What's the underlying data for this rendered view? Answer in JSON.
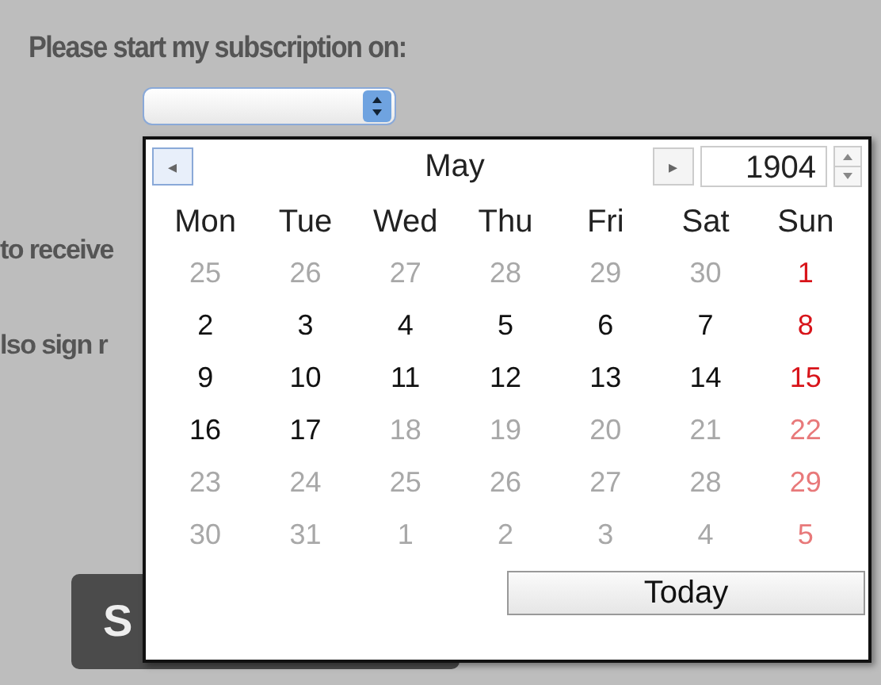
{
  "form": {
    "heading": "Please start my subscription on:",
    "partial_line_1": "to receive",
    "partial_line_2": "lso sign r",
    "submit_button": "S"
  },
  "calendar": {
    "prev_button": "◂",
    "month": "May",
    "next_button": "▸",
    "year": "1904",
    "weekdays": [
      "Mon",
      "Tue",
      "Wed",
      "Thu",
      "Fri",
      "Sat",
      "Sun"
    ],
    "weeks": [
      [
        {
          "day": "25",
          "disabled": true,
          "holiday": false
        },
        {
          "day": "26",
          "disabled": true,
          "holiday": false
        },
        {
          "day": "27",
          "disabled": true,
          "holiday": false
        },
        {
          "day": "28",
          "disabled": true,
          "holiday": false
        },
        {
          "day": "29",
          "disabled": true,
          "holiday": false
        },
        {
          "day": "30",
          "disabled": true,
          "holiday": false
        },
        {
          "day": "1",
          "disabled": false,
          "holiday": true
        }
      ],
      [
        {
          "day": "2",
          "disabled": false,
          "holiday": false
        },
        {
          "day": "3",
          "disabled": false,
          "holiday": false
        },
        {
          "day": "4",
          "disabled": false,
          "holiday": false
        },
        {
          "day": "5",
          "disabled": false,
          "holiday": false
        },
        {
          "day": "6",
          "disabled": false,
          "holiday": false
        },
        {
          "day": "7",
          "disabled": false,
          "holiday": false
        },
        {
          "day": "8",
          "disabled": false,
          "holiday": true
        }
      ],
      [
        {
          "day": "9",
          "disabled": false,
          "holiday": false
        },
        {
          "day": "10",
          "disabled": false,
          "holiday": false
        },
        {
          "day": "11",
          "disabled": false,
          "holiday": false
        },
        {
          "day": "12",
          "disabled": false,
          "holiday": false
        },
        {
          "day": "13",
          "disabled": false,
          "holiday": false
        },
        {
          "day": "14",
          "disabled": false,
          "holiday": false
        },
        {
          "day": "15",
          "disabled": false,
          "holiday": true
        }
      ],
      [
        {
          "day": "16",
          "disabled": false,
          "holiday": false
        },
        {
          "day": "17",
          "disabled": false,
          "holiday": false
        },
        {
          "day": "18",
          "disabled": true,
          "holiday": false
        },
        {
          "day": "19",
          "disabled": true,
          "holiday": false
        },
        {
          "day": "20",
          "disabled": true,
          "holiday": false
        },
        {
          "day": "21",
          "disabled": true,
          "holiday": false
        },
        {
          "day": "22",
          "disabled": true,
          "holiday": true
        }
      ],
      [
        {
          "day": "23",
          "disabled": true,
          "holiday": false
        },
        {
          "day": "24",
          "disabled": true,
          "holiday": false
        },
        {
          "day": "25",
          "disabled": true,
          "holiday": false
        },
        {
          "day": "26",
          "disabled": true,
          "holiday": false
        },
        {
          "day": "27",
          "disabled": true,
          "holiday": false
        },
        {
          "day": "28",
          "disabled": true,
          "holiday": false
        },
        {
          "day": "29",
          "disabled": true,
          "holiday": true
        }
      ],
      [
        {
          "day": "30",
          "disabled": true,
          "holiday": false
        },
        {
          "day": "31",
          "disabled": true,
          "holiday": false
        },
        {
          "day": "1",
          "disabled": true,
          "holiday": false
        },
        {
          "day": "2",
          "disabled": true,
          "holiday": false
        },
        {
          "day": "3",
          "disabled": true,
          "holiday": false
        },
        {
          "day": "4",
          "disabled": true,
          "holiday": false
        },
        {
          "day": "5",
          "disabled": true,
          "holiday": true
        }
      ]
    ],
    "today_button": "Today"
  }
}
